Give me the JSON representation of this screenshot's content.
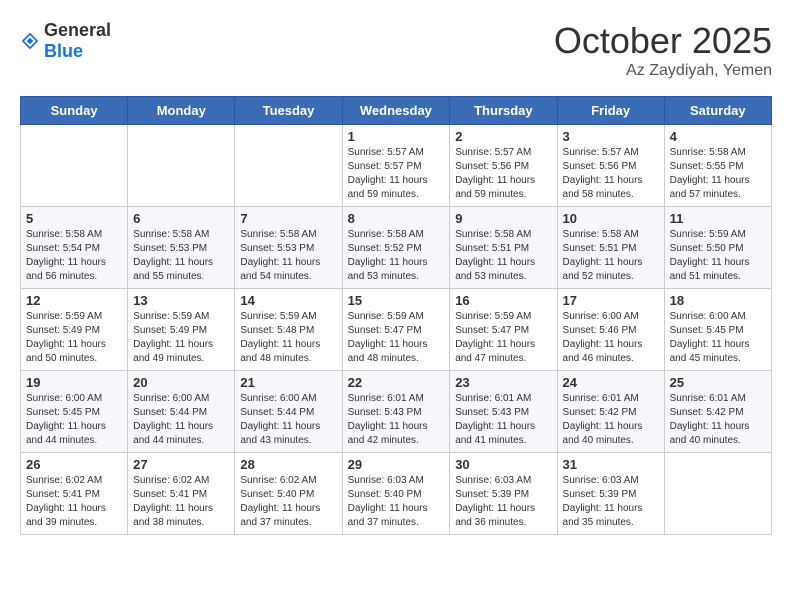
{
  "logo": {
    "general": "General",
    "blue": "Blue"
  },
  "title": "October 2025",
  "location": "Az Zaydiyah, Yemen",
  "days_header": [
    "Sunday",
    "Monday",
    "Tuesday",
    "Wednesday",
    "Thursday",
    "Friday",
    "Saturday"
  ],
  "weeks": [
    [
      {
        "day": "",
        "info": ""
      },
      {
        "day": "",
        "info": ""
      },
      {
        "day": "",
        "info": ""
      },
      {
        "day": "1",
        "info": "Sunrise: 5:57 AM\nSunset: 5:57 PM\nDaylight: 11 hours and 59 minutes."
      },
      {
        "day": "2",
        "info": "Sunrise: 5:57 AM\nSunset: 5:56 PM\nDaylight: 11 hours and 59 minutes."
      },
      {
        "day": "3",
        "info": "Sunrise: 5:57 AM\nSunset: 5:56 PM\nDaylight: 11 hours and 58 minutes."
      },
      {
        "day": "4",
        "info": "Sunrise: 5:58 AM\nSunset: 5:55 PM\nDaylight: 11 hours and 57 minutes."
      }
    ],
    [
      {
        "day": "5",
        "info": "Sunrise: 5:58 AM\nSunset: 5:54 PM\nDaylight: 11 hours and 56 minutes."
      },
      {
        "day": "6",
        "info": "Sunrise: 5:58 AM\nSunset: 5:53 PM\nDaylight: 11 hours and 55 minutes."
      },
      {
        "day": "7",
        "info": "Sunrise: 5:58 AM\nSunset: 5:53 PM\nDaylight: 11 hours and 54 minutes."
      },
      {
        "day": "8",
        "info": "Sunrise: 5:58 AM\nSunset: 5:52 PM\nDaylight: 11 hours and 53 minutes."
      },
      {
        "day": "9",
        "info": "Sunrise: 5:58 AM\nSunset: 5:51 PM\nDaylight: 11 hours and 53 minutes."
      },
      {
        "day": "10",
        "info": "Sunrise: 5:58 AM\nSunset: 5:51 PM\nDaylight: 11 hours and 52 minutes."
      },
      {
        "day": "11",
        "info": "Sunrise: 5:59 AM\nSunset: 5:50 PM\nDaylight: 11 hours and 51 minutes."
      }
    ],
    [
      {
        "day": "12",
        "info": "Sunrise: 5:59 AM\nSunset: 5:49 PM\nDaylight: 11 hours and 50 minutes."
      },
      {
        "day": "13",
        "info": "Sunrise: 5:59 AM\nSunset: 5:49 PM\nDaylight: 11 hours and 49 minutes."
      },
      {
        "day": "14",
        "info": "Sunrise: 5:59 AM\nSunset: 5:48 PM\nDaylight: 11 hours and 48 minutes."
      },
      {
        "day": "15",
        "info": "Sunrise: 5:59 AM\nSunset: 5:47 PM\nDaylight: 11 hours and 48 minutes."
      },
      {
        "day": "16",
        "info": "Sunrise: 5:59 AM\nSunset: 5:47 PM\nDaylight: 11 hours and 47 minutes."
      },
      {
        "day": "17",
        "info": "Sunrise: 6:00 AM\nSunset: 5:46 PM\nDaylight: 11 hours and 46 minutes."
      },
      {
        "day": "18",
        "info": "Sunrise: 6:00 AM\nSunset: 5:45 PM\nDaylight: 11 hours and 45 minutes."
      }
    ],
    [
      {
        "day": "19",
        "info": "Sunrise: 6:00 AM\nSunset: 5:45 PM\nDaylight: 11 hours and 44 minutes."
      },
      {
        "day": "20",
        "info": "Sunrise: 6:00 AM\nSunset: 5:44 PM\nDaylight: 11 hours and 44 minutes."
      },
      {
        "day": "21",
        "info": "Sunrise: 6:00 AM\nSunset: 5:44 PM\nDaylight: 11 hours and 43 minutes."
      },
      {
        "day": "22",
        "info": "Sunrise: 6:01 AM\nSunset: 5:43 PM\nDaylight: 11 hours and 42 minutes."
      },
      {
        "day": "23",
        "info": "Sunrise: 6:01 AM\nSunset: 5:43 PM\nDaylight: 11 hours and 41 minutes."
      },
      {
        "day": "24",
        "info": "Sunrise: 6:01 AM\nSunset: 5:42 PM\nDaylight: 11 hours and 40 minutes."
      },
      {
        "day": "25",
        "info": "Sunrise: 6:01 AM\nSunset: 5:42 PM\nDaylight: 11 hours and 40 minutes."
      }
    ],
    [
      {
        "day": "26",
        "info": "Sunrise: 6:02 AM\nSunset: 5:41 PM\nDaylight: 11 hours and 39 minutes."
      },
      {
        "day": "27",
        "info": "Sunrise: 6:02 AM\nSunset: 5:41 PM\nDaylight: 11 hours and 38 minutes."
      },
      {
        "day": "28",
        "info": "Sunrise: 6:02 AM\nSunset: 5:40 PM\nDaylight: 11 hours and 37 minutes."
      },
      {
        "day": "29",
        "info": "Sunrise: 6:03 AM\nSunset: 5:40 PM\nDaylight: 11 hours and 37 minutes."
      },
      {
        "day": "30",
        "info": "Sunrise: 6:03 AM\nSunset: 5:39 PM\nDaylight: 11 hours and 36 minutes."
      },
      {
        "day": "31",
        "info": "Sunrise: 6:03 AM\nSunset: 5:39 PM\nDaylight: 11 hours and 35 minutes."
      },
      {
        "day": "",
        "info": ""
      }
    ]
  ]
}
